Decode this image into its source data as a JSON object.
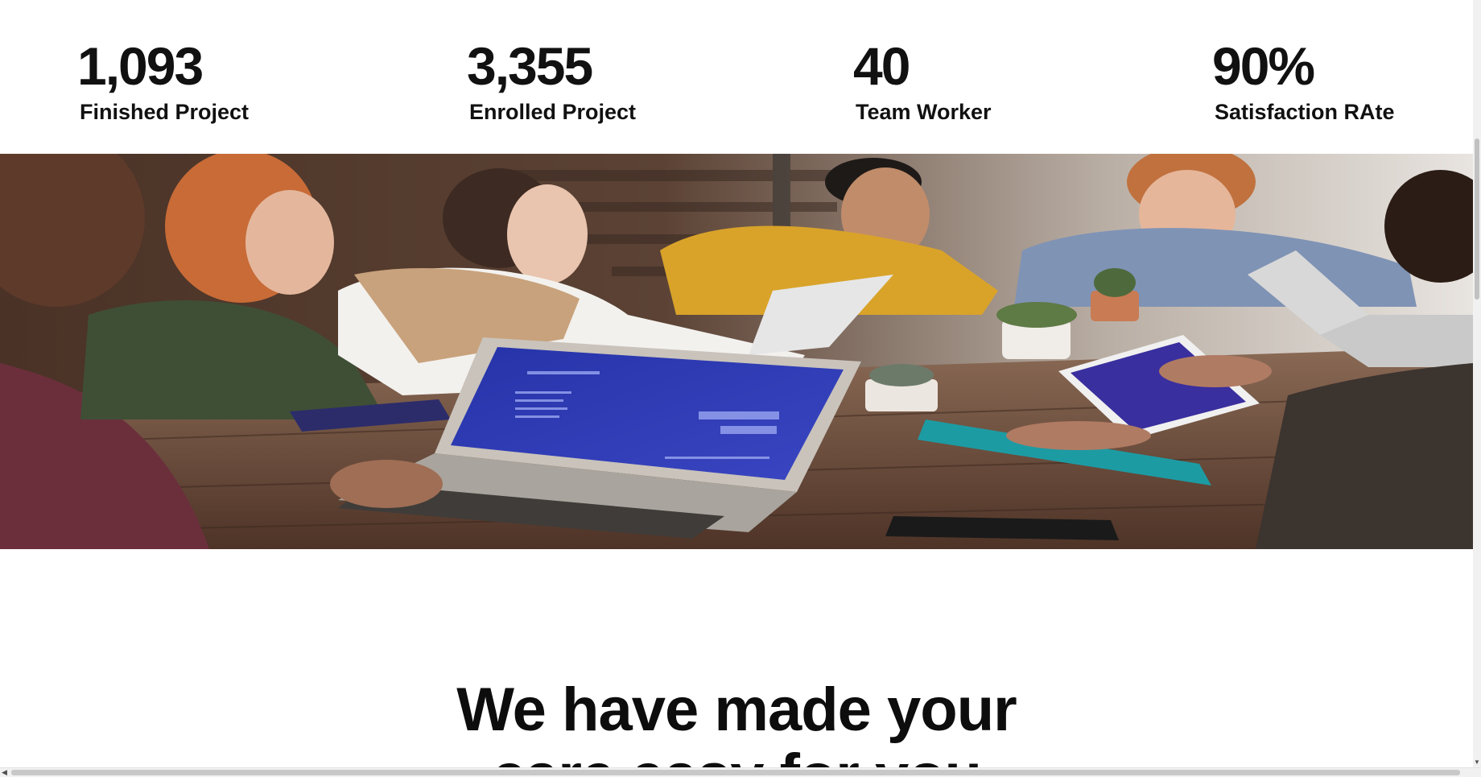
{
  "stats": [
    {
      "value": "1,093",
      "label": "Finished Project"
    },
    {
      "value": "3,355",
      "label": "Enrolled Project"
    },
    {
      "value": "40",
      "label": "Team Worker"
    },
    {
      "value": "90%",
      "label": "Satisfaction RAte"
    }
  ],
  "hero_image": {
    "icon": "team-meeting-photo",
    "colors": {
      "table": "#6b4a36",
      "laptop_screen": "#2a2f9e",
      "jacket_yellow": "#d9a32a",
      "sweater_green": "#3f4f36",
      "shirt_blue": "#7f93b5"
    }
  },
  "headline": {
    "line1": "We have made your",
    "line2": "care easy for you"
  },
  "scrollbars": {
    "up_icon": "scroll-arrow-up-icon",
    "down_icon": "scroll-arrow-down-icon",
    "left_icon": "scroll-arrow-left-icon"
  }
}
